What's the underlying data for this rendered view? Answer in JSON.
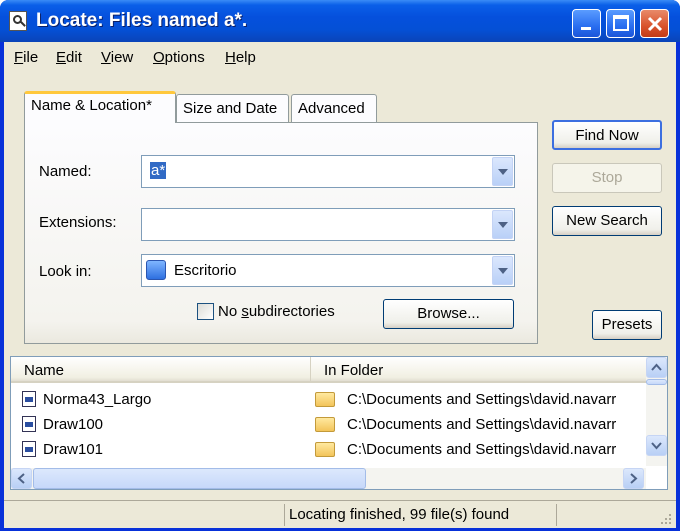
{
  "window": {
    "title": "Locate: Files named a*."
  },
  "menu": [
    {
      "label": "File",
      "u": "F",
      "rest": "ile"
    },
    {
      "label": "Edit",
      "u": "E",
      "rest": "dit"
    },
    {
      "label": "View",
      "u": "V",
      "rest": "iew"
    },
    {
      "label": "Options",
      "u": "O",
      "rest": "ptions"
    },
    {
      "label": "Help",
      "u": "H",
      "rest": "elp"
    }
  ],
  "tabs": [
    "Name & Location*",
    "Size and Date",
    "Advanced"
  ],
  "form": {
    "named_label": "Named:",
    "named_value": "a*",
    "extensions_label": "Extensions:",
    "extensions_value": "",
    "lookin_label": "Look in:",
    "lookin_value": "Escritorio",
    "no_subdirs_label": "No subdirectories",
    "no_subdirs_checked": false,
    "browse_label": "Browse..."
  },
  "buttons": {
    "find_now": "Find Now",
    "stop": "Stop",
    "new_search": "New Search",
    "presets": "Presets"
  },
  "results": {
    "columns": [
      "Name",
      "In Folder"
    ],
    "rows": [
      {
        "name": "Norma43_Largo",
        "folder": "C:\\Documents and Settings\\david.navarr"
      },
      {
        "name": "Draw100",
        "folder": "C:\\Documents and Settings\\david.navarr"
      },
      {
        "name": "Draw101",
        "folder": "C:\\Documents and Settings\\david.navarr"
      }
    ]
  },
  "status": {
    "text": "Locating finished, 99 file(s) found"
  },
  "icons": [
    "search-app-icon",
    "minimize-icon",
    "maximize-icon",
    "close-icon",
    "combo-arrow-icon",
    "desktop-icon",
    "file-icon",
    "folder-icon",
    "scroll-up-icon",
    "scroll-down-icon",
    "scroll-left-icon",
    "scroll-right-icon",
    "resize-grip-icon"
  ]
}
